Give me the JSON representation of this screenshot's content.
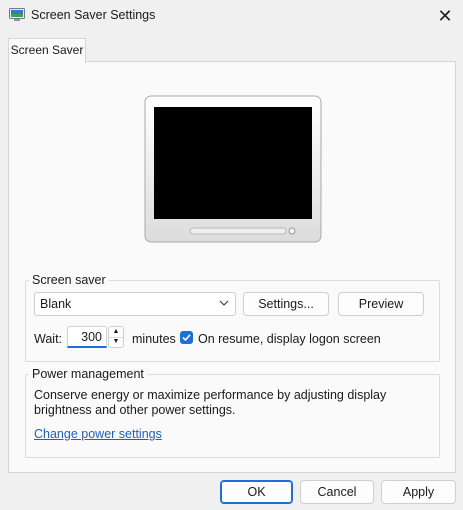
{
  "window": {
    "title": "Screen Saver Settings",
    "close_icon": "close-icon",
    "app_icon": "screen-saver-app-icon"
  },
  "tabs": [
    {
      "label": "Screen Saver",
      "selected": true
    }
  ],
  "screen_saver": {
    "group_label": "Screen saver",
    "selected": "Blank",
    "settings_label": "Settings...",
    "preview_label": "Preview",
    "wait_label": "Wait:",
    "wait_value": "300",
    "minutes_label": "minutes",
    "resume_checked": true,
    "resume_label": "On resume, display logon screen"
  },
  "power": {
    "group_label": "Power management",
    "description": "Conserve energy or maximize performance by adjusting display brightness and other power settings.",
    "link": "Change power settings"
  },
  "footer": {
    "ok": "OK",
    "cancel": "Cancel",
    "apply": "Apply"
  },
  "colors": {
    "accent": "#1f6fd6",
    "link": "#1f5fbf",
    "dialog_bg": "#f0f0f0",
    "panel_bg": "#fafafa"
  }
}
